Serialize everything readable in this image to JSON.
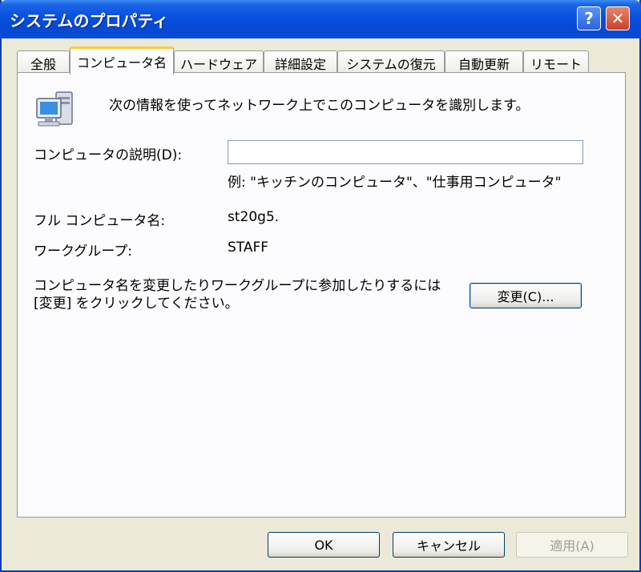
{
  "window": {
    "title": "システムのプロパティ",
    "help_label": "?",
    "close_label": "✕"
  },
  "tabs": [
    {
      "label": "全般"
    },
    {
      "label": "コンピュータ名"
    },
    {
      "label": "ハードウェア"
    },
    {
      "label": "詳細設定"
    },
    {
      "label": "システムの復元"
    },
    {
      "label": "自動更新"
    },
    {
      "label": "リモート"
    }
  ],
  "active_tab": "コンピュータ名",
  "content": {
    "intro": "次の情報を使ってネットワーク上でこのコンピュータを識別します。",
    "description_label": "コンピュータの説明(D):",
    "description_value": "",
    "example": "例: \"キッチンのコンピュータ\"、\"仕事用コンピュータ\"",
    "fullname_label": "フル コンピュータ名:",
    "fullname_value": "st20g5.",
    "workgroup_label": "ワークグループ:",
    "workgroup_value": "STAFF",
    "change_text": "コンピュータ名を変更したりワークグループに参加したりするには [変更] をクリックしてください。",
    "change_button": "変更(C)..."
  },
  "footer": {
    "ok": "OK",
    "cancel": "キャンセル",
    "apply": "適用(A)"
  },
  "icons": {
    "computer": "network-computer-icon"
  },
  "colors": {
    "titlebar": "#0a52e0",
    "active_tab_accent": "#ffc83c",
    "dialog_bg": "#ece9d8"
  }
}
